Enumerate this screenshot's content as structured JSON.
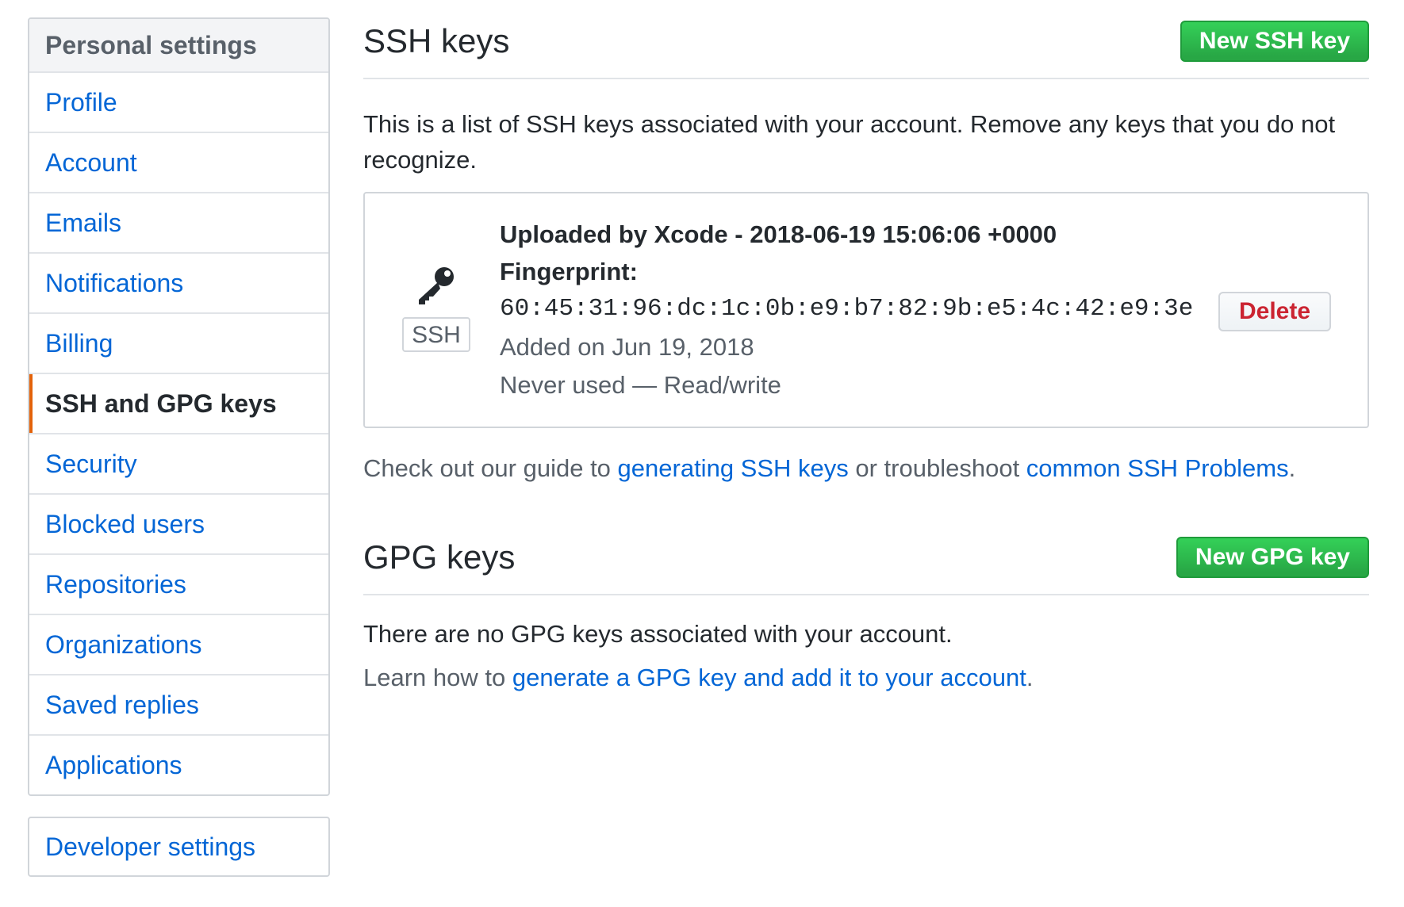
{
  "sidebar": {
    "heading": "Personal settings",
    "items": [
      {
        "label": "Profile"
      },
      {
        "label": "Account"
      },
      {
        "label": "Emails"
      },
      {
        "label": "Notifications"
      },
      {
        "label": "Billing"
      },
      {
        "label": "SSH and GPG keys",
        "selected": true
      },
      {
        "label": "Security"
      },
      {
        "label": "Blocked users"
      },
      {
        "label": "Repositories"
      },
      {
        "label": "Organizations"
      },
      {
        "label": "Saved replies"
      },
      {
        "label": "Applications"
      }
    ],
    "developer_settings": "Developer settings"
  },
  "ssh": {
    "title": "SSH keys",
    "new_button": "New SSH key",
    "intro": "This is a list of SSH keys associated with your account. Remove any keys that you do not recognize.",
    "key": {
      "icon": "key-icon",
      "badge": "SSH",
      "title": "Uploaded by Xcode - 2018-06-19 15:06:06 +0000",
      "fingerprint_label": "Fingerprint:",
      "fingerprint": "60:45:31:96:dc:1c:0b:e9:b7:82:9b:e5:4c:42:e9:3e",
      "added": "Added on Jun 19, 2018",
      "usage": "Never used — Read/write",
      "delete_label": "Delete"
    },
    "guide": {
      "prefix": "Check out our guide to ",
      "link1": "generating SSH keys",
      "middle": " or troubleshoot ",
      "link2": "common SSH Problems",
      "suffix": "."
    }
  },
  "gpg": {
    "title": "GPG keys",
    "new_button": "New GPG key",
    "empty": "There are no GPG keys associated with your account.",
    "learn_prefix": "Learn how to ",
    "learn_link": "generate a GPG key and add it to your account",
    "learn_suffix": "."
  },
  "colors": {
    "link": "#0366d6",
    "green": "#28a745",
    "danger": "#cb2431",
    "selected_marker": "#e36209"
  }
}
